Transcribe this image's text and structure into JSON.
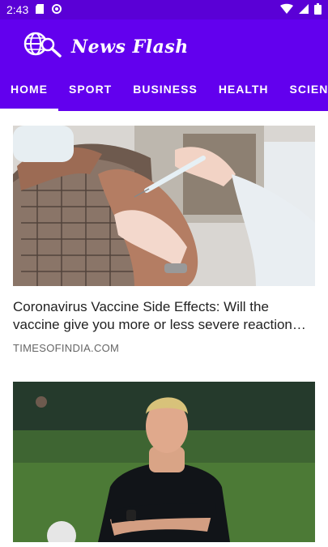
{
  "status": {
    "time": "2:43"
  },
  "app": {
    "title": "News Flash"
  },
  "tabs": [
    {
      "label": "HOME",
      "active": true
    },
    {
      "label": "SPORT",
      "active": false
    },
    {
      "label": "BUSINESS",
      "active": false
    },
    {
      "label": "HEALTH",
      "active": false
    },
    {
      "label": "SCIENCE",
      "active": false
    }
  ],
  "articles": [
    {
      "title": "Coronavirus Vaccine Side Effects: Will the vaccine give you more or less severe reaction…",
      "source": "TIMESOFINDIA.COM",
      "image": "vaccine-injection-photo"
    },
    {
      "image": "coach-crossed-arms-photo"
    }
  ],
  "colors": {
    "statusbar": "#5a00d6",
    "appbar": "#6200ee",
    "indicator": "#ffffff"
  }
}
